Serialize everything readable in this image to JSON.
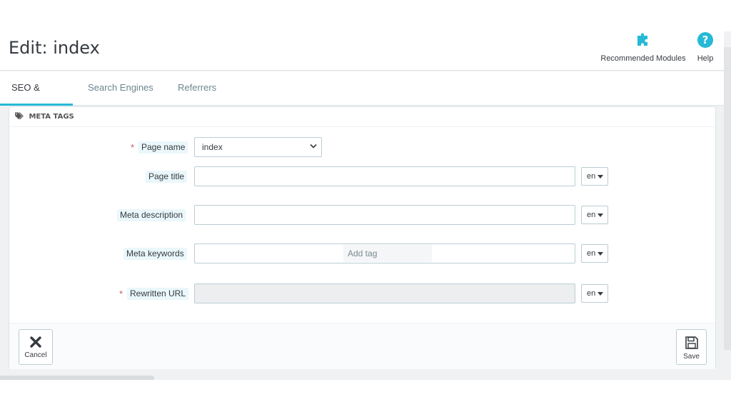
{
  "header": {
    "title": "Edit: index",
    "toolbar": [
      {
        "id": "recommended-modules",
        "label": "Recommended Modules",
        "icon": "puzzle-icon"
      },
      {
        "id": "help",
        "label": "Help",
        "icon": "help-circle-icon"
      }
    ]
  },
  "tabs": [
    {
      "label": "SEO & URLs",
      "active": true
    },
    {
      "label": "Search Engines",
      "active": false
    },
    {
      "label": "Referrers",
      "active": false
    }
  ],
  "panel": {
    "heading": "META TAGS",
    "heading_icon": "tags-icon",
    "fields": {
      "page_name": {
        "label": "Page name",
        "required": true,
        "value": "index"
      },
      "page_title": {
        "label": "Page title",
        "required": false,
        "value": "",
        "lang": "en"
      },
      "meta_description": {
        "label": "Meta description",
        "required": false,
        "value": "",
        "lang": "en"
      },
      "meta_keywords": {
        "label": "Meta keywords",
        "required": false,
        "placeholder": "Add tag",
        "lang": "en"
      },
      "rewritten_url": {
        "label": "Rewritten URL",
        "required": true,
        "value": "",
        "lang": "en"
      }
    },
    "footer": {
      "cancel_label": "Cancel",
      "save_label": "Save"
    }
  },
  "colors": {
    "accent": "#25b9d7",
    "required": "#c05c67",
    "label_bg": "#eaf7fb",
    "text": "#363a41"
  }
}
